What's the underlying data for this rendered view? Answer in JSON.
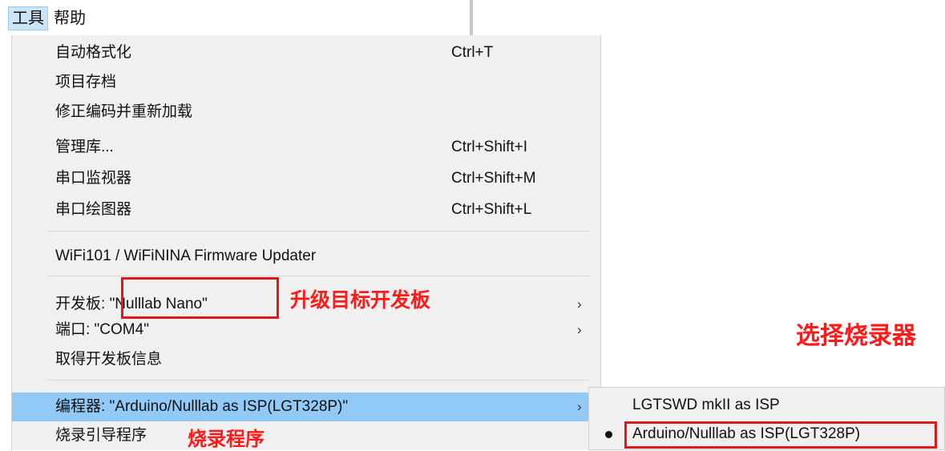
{
  "menubar": {
    "tools": "工具",
    "help": "帮助"
  },
  "menu": {
    "items": [
      {
        "label": "自动格式化",
        "shortcut": "Ctrl+T"
      },
      {
        "label": "项目存档",
        "shortcut": ""
      },
      {
        "label": "修正编码并重新加载",
        "shortcut": ""
      },
      {
        "label": "管理库...",
        "shortcut": "Ctrl+Shift+I"
      },
      {
        "label": "串口监视器",
        "shortcut": "Ctrl+Shift+M"
      },
      {
        "label": "串口绘图器",
        "shortcut": "Ctrl+Shift+L"
      },
      {
        "label": "WiFi101 / WiFiNINA Firmware Updater",
        "shortcut": ""
      },
      {
        "label_prefix": "开发板: ",
        "label_value": "\"Nulllab Nano\"",
        "arrow": "›"
      },
      {
        "label": "端口: \"COM4\"",
        "arrow": "›"
      },
      {
        "label": "取得开发板信息"
      },
      {
        "label": "编程器: \"Arduino/Nulllab as ISP(LGT328P)\"",
        "arrow": "›"
      },
      {
        "label": "烧录引导程序"
      }
    ]
  },
  "submenu": {
    "items": [
      {
        "label": "LGTSWD mkII as ISP"
      },
      {
        "label": "Arduino/Nulllab as ISP(LGT328P)",
        "selected": true
      }
    ]
  },
  "annotations": {
    "upgrade_board": "升级目标开发板",
    "select_programmer": "选择烧录器",
    "burn_program": "烧录程序"
  },
  "colors": {
    "highlight": "#91c9f7",
    "annotation_red": "#ff1a1a",
    "menu_bg": "#f0f0f0"
  }
}
